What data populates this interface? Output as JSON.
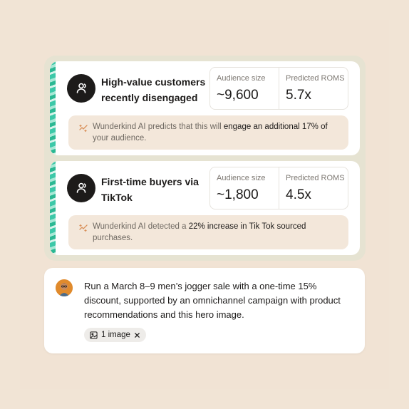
{
  "segments": [
    {
      "title": "High-value customers recently disengaged",
      "stats": [
        {
          "label": "Audience size",
          "value": "~9,600"
        },
        {
          "label": "Predicted ROMS",
          "value": "5.7x"
        }
      ],
      "ai_prefix": "Wunderkind AI predicts that this will ",
      "ai_emphasis": "engage an additional 17% of",
      "ai_suffix": "your audience."
    },
    {
      "title": "First-time buyers via TikTok",
      "stats": [
        {
          "label": "Audience size",
          "value": "~1,800"
        },
        {
          "label": "Predicted ROMS",
          "value": "4.5x"
        }
      ],
      "ai_prefix": "Wunderkind AI detected a ",
      "ai_emphasis": "22% increase in Tik Tok sourced",
      "ai_suffix": "purchases."
    }
  ],
  "prompt": {
    "text": "Run a March 8–9 men’s jogger sale with a one-time 15% discount, supported by an omnichannel campaign with product recommendations and this hero image.",
    "attachment_label": "1 image"
  },
  "icons": {
    "segment": "users-icon",
    "ai": "sparkle-icon",
    "attachment": "image-icon",
    "remove": "close-icon"
  },
  "colors": {
    "background": "#f1e4d5",
    "accent_stripe": "#3cc8a8",
    "note_bg": "#f3e7da",
    "ai_icon": "#d9905a"
  }
}
